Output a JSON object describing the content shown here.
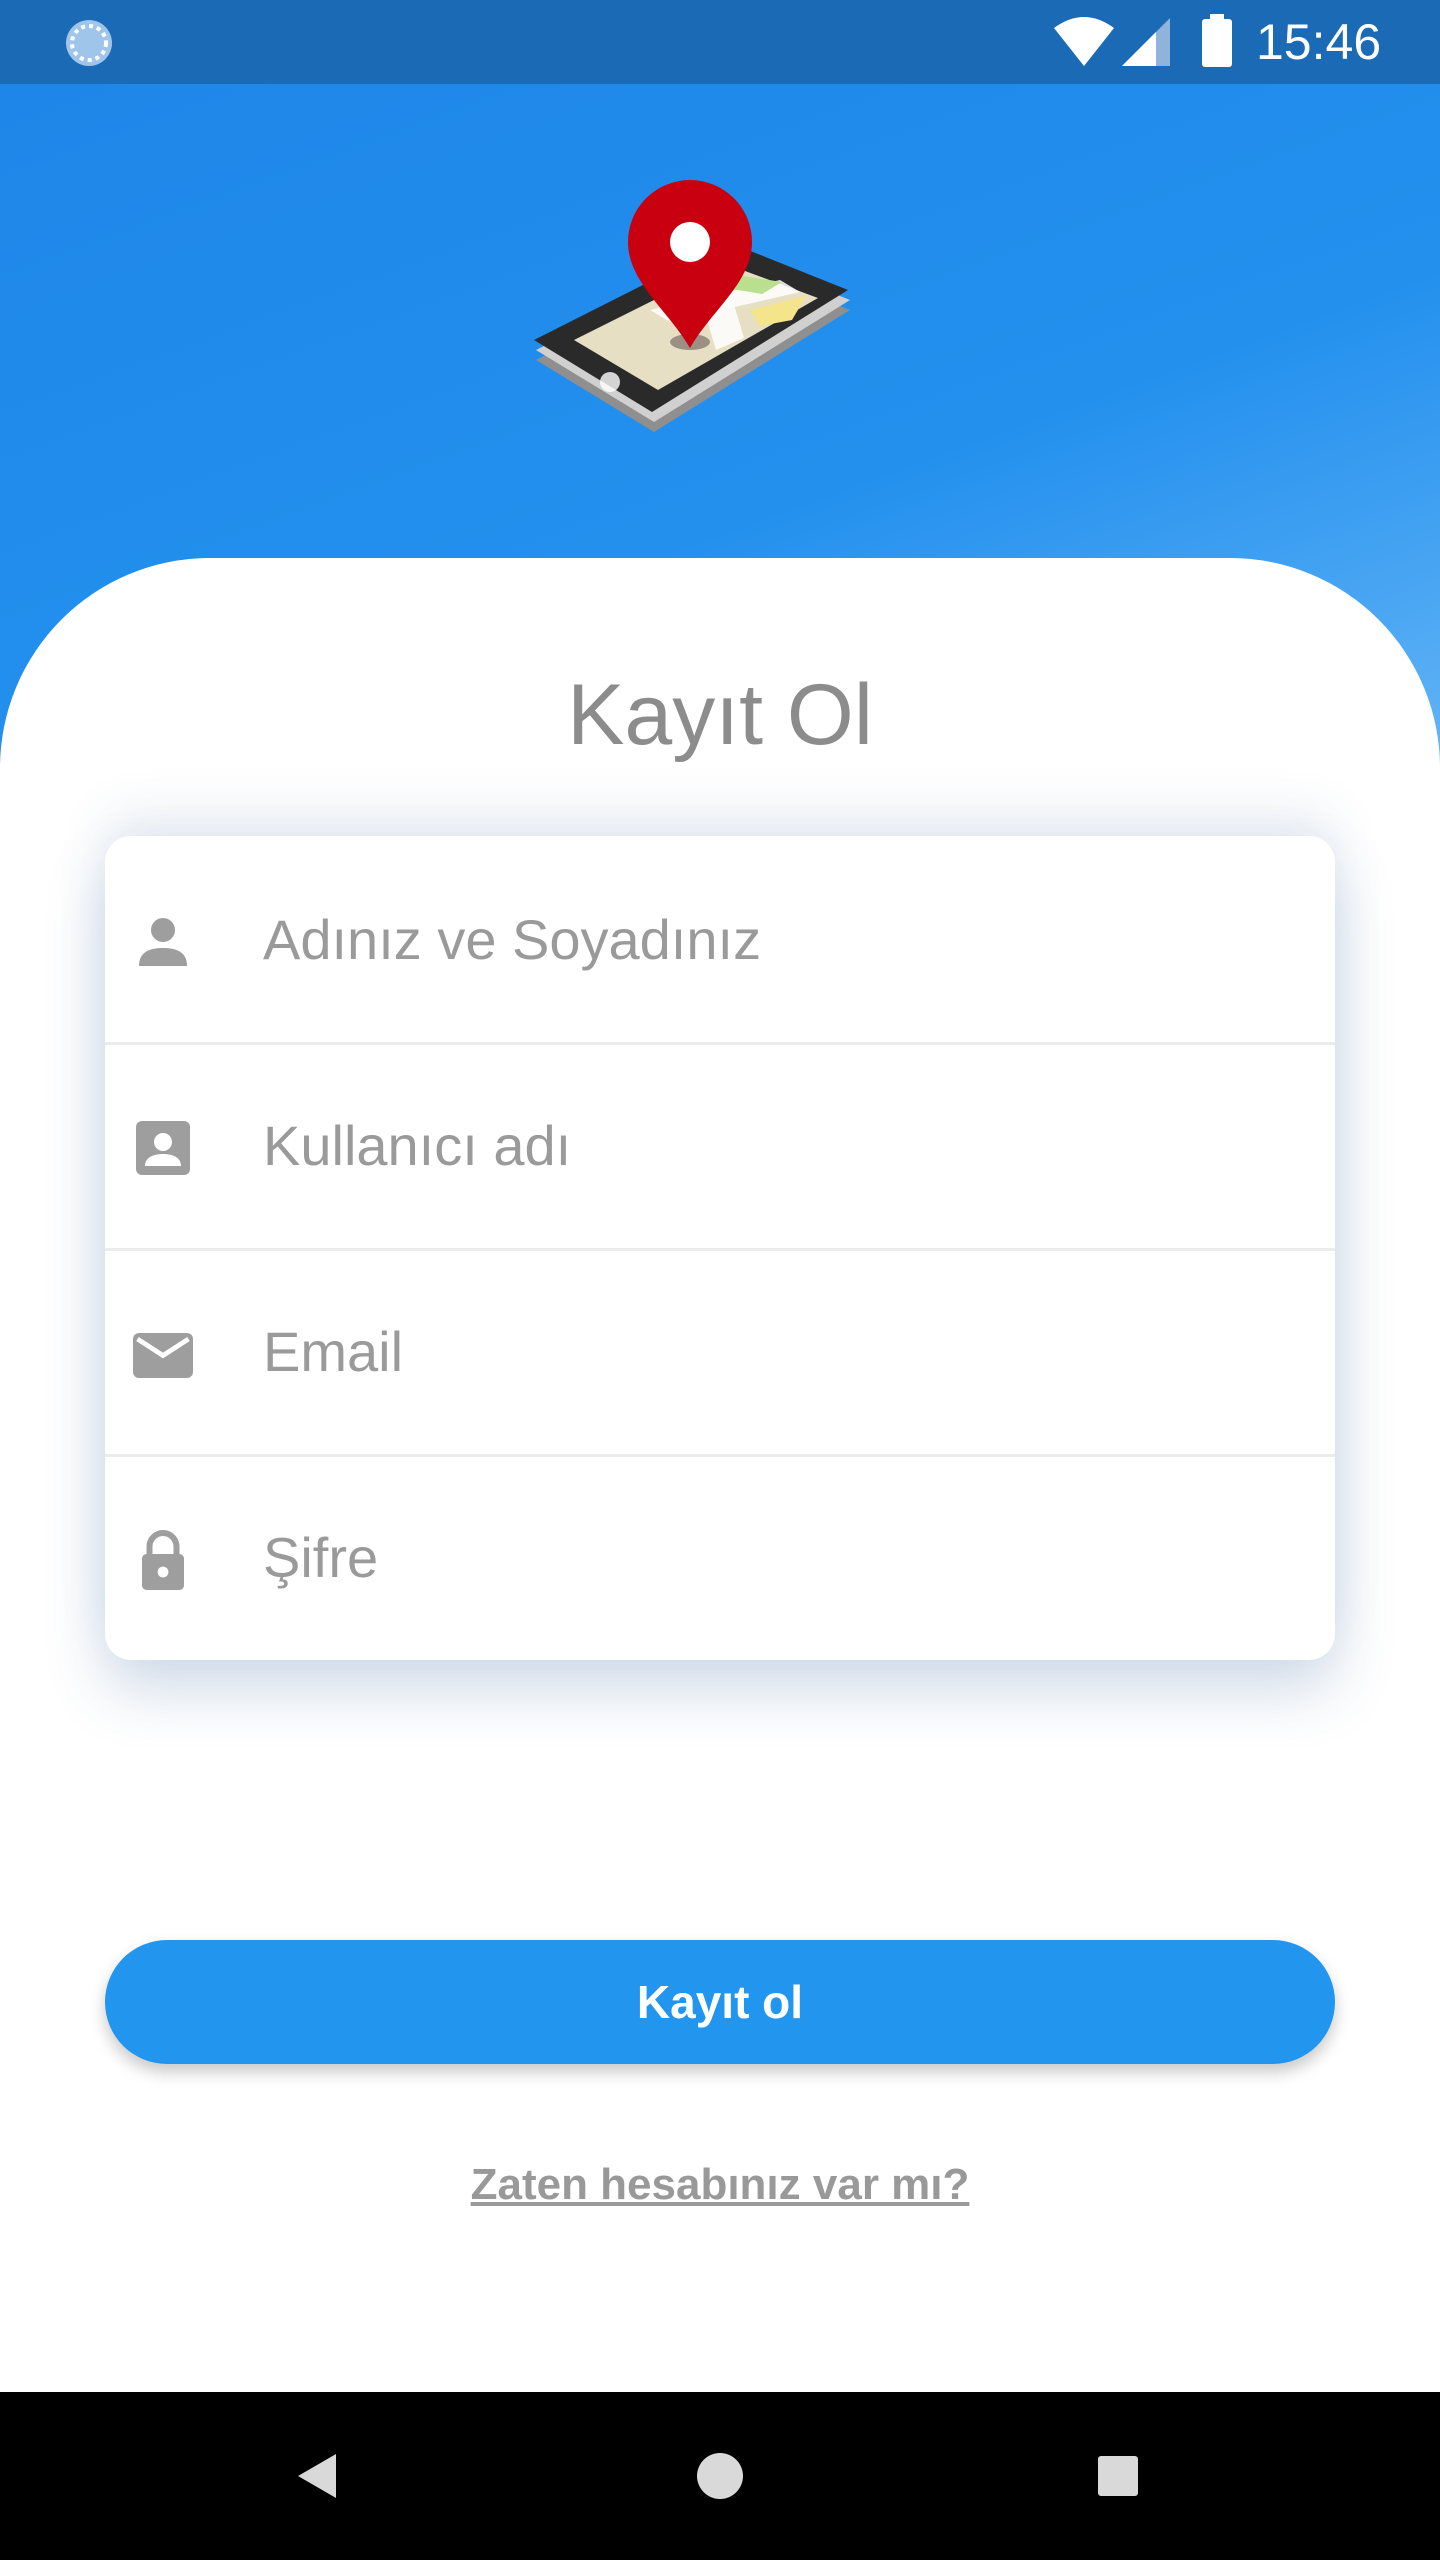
{
  "status_bar": {
    "time": "15:46",
    "left_icon": "sync-spinner-icon",
    "icons": [
      "wifi-icon",
      "signal-icon",
      "battery-icon"
    ]
  },
  "header": {
    "logo": "map-pin-phone-logo"
  },
  "form": {
    "title": "Kayıt Ol",
    "fields": [
      {
        "icon": "person-icon",
        "placeholder": "Adınız ve Soyadınız",
        "value": ""
      },
      {
        "icon": "contact-card-icon",
        "placeholder": "Kullanıcı adı",
        "value": ""
      },
      {
        "icon": "mail-icon",
        "placeholder": "Email",
        "value": ""
      },
      {
        "icon": "lock-icon",
        "placeholder": "Şifre",
        "value": ""
      }
    ],
    "submit_label": "Kayıt ol",
    "login_link": "Zaten hesabınız var mı?"
  },
  "navigation": {
    "buttons": [
      "back-icon",
      "home-icon",
      "recent-apps-icon"
    ]
  },
  "colors": {
    "status_bar": "#1a6ab6",
    "header_gradient_start": "#1e86e8",
    "header_gradient_end": "#6ebbf6",
    "accent": "#2295ef",
    "pin_red": "#c8000f",
    "text_gray": "#8c8c8c",
    "icon_gray": "#9e9e9e"
  }
}
